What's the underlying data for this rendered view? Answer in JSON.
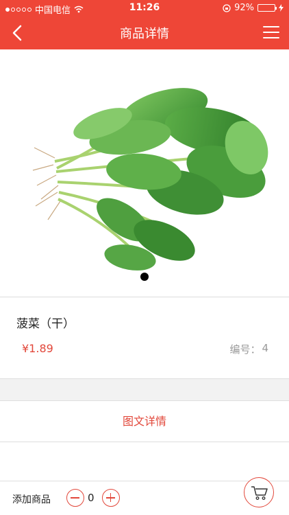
{
  "status_bar": {
    "carrier": "中国电信",
    "time": "11:26",
    "battery": "92%",
    "battery_level": 0.92
  },
  "nav": {
    "title": "商品详情"
  },
  "product": {
    "name": "菠菜（干）",
    "price": "¥1.89",
    "code_label": "编号：",
    "code_value": "4",
    "image_icon": "spinach-image",
    "carousel_pages": 1
  },
  "detail_link": "图文详情",
  "bottom_bar": {
    "add_label": "添加商品",
    "quantity": "0"
  },
  "colors": {
    "accent": "#ee4637",
    "price": "#e2473a"
  }
}
